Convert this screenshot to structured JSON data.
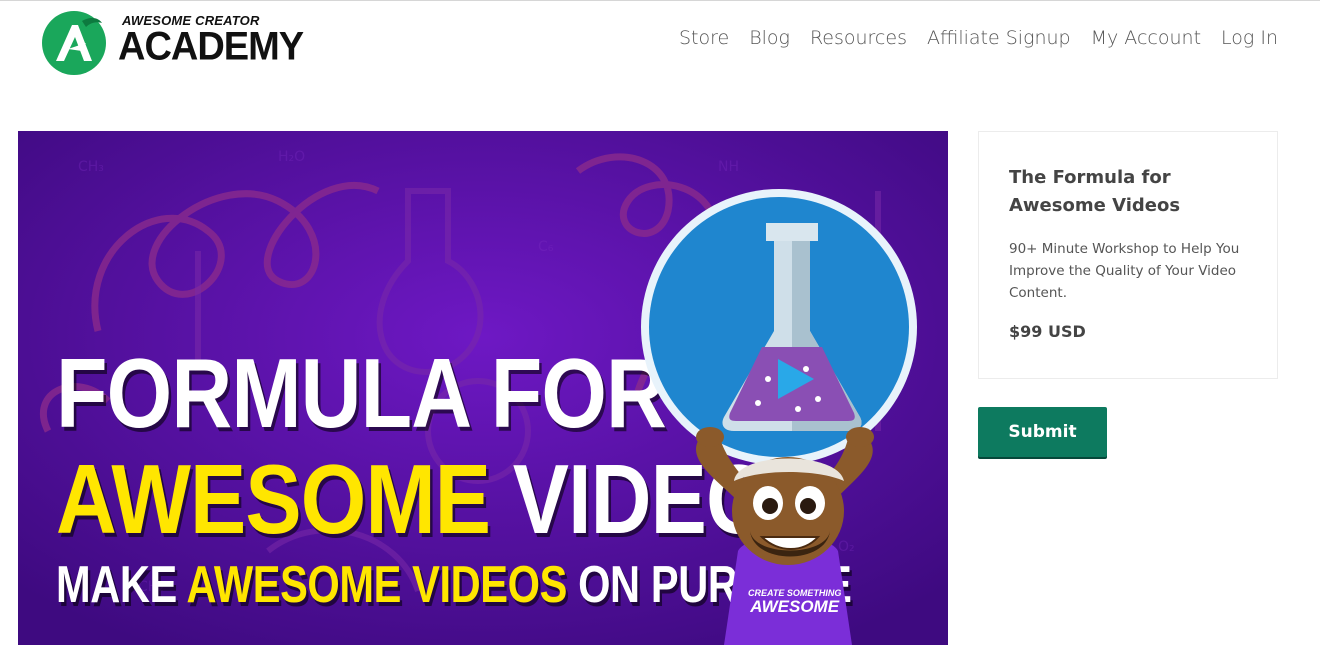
{
  "header": {
    "logo": {
      "line1": "AWESOME CREATOR",
      "line2": "ACADEMY"
    },
    "nav": [
      "Store",
      "Blog",
      "Resources",
      "Affiliate Signup",
      "My Account",
      "Log In"
    ]
  },
  "hero": {
    "line1": "FORMULA FOR",
    "line2_highlight": "AWESOME",
    "line2_rest": "VIDEOS",
    "line3_a": "MAKE",
    "line3_highlight": "AWESOME VIDEOS",
    "line3_c": "ON PURPOSE",
    "shirt_line1": "CREATE SOMETHING",
    "shirt_line2": "AWESOME"
  },
  "product": {
    "title": "The Formula for Awesome Videos",
    "description": "90+ Minute Workshop to Help You Improve the Quality of Your Video Content.",
    "price": "$99 USD"
  },
  "actions": {
    "submit_label": "Submit"
  },
  "colors": {
    "brand_green": "#1aa75b",
    "button_green": "#0d7a5f",
    "hero_purple": "#5a10a6",
    "hero_yellow": "#ffe600"
  }
}
